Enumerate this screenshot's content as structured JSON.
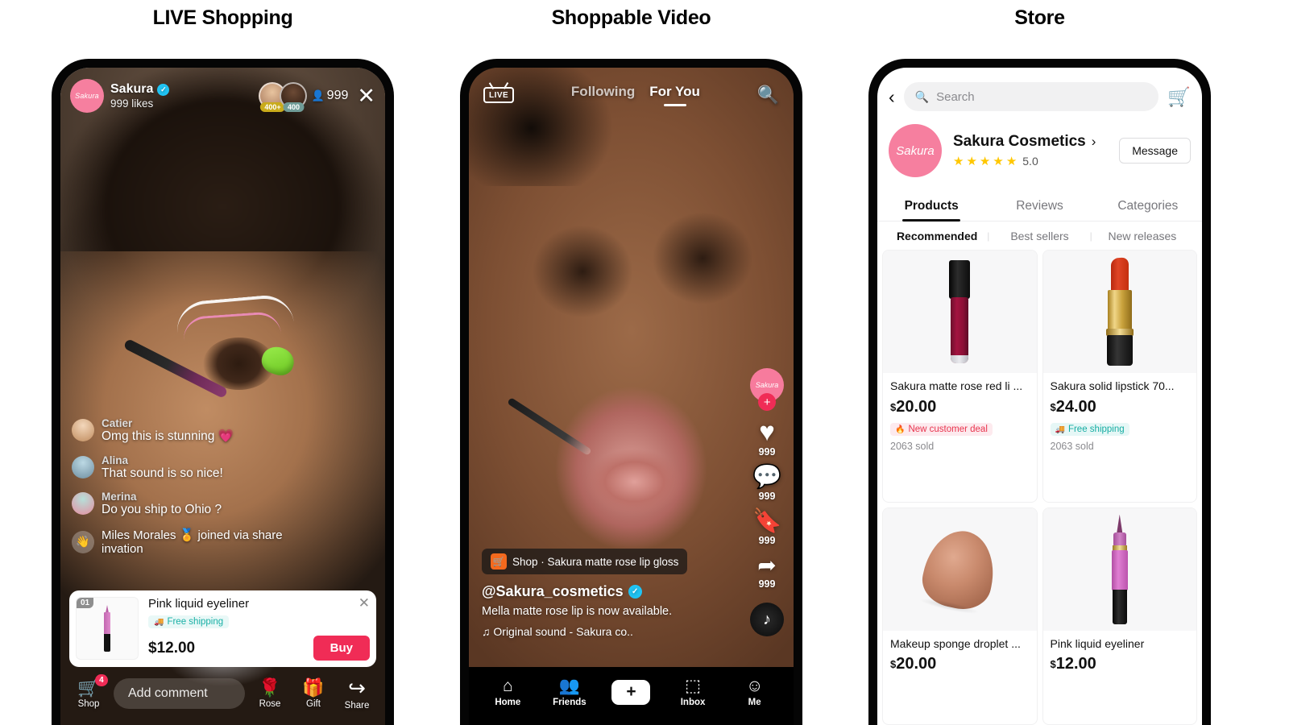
{
  "columns": [
    {
      "title": "LIVE Shopping"
    },
    {
      "title": "Shoppable Video"
    },
    {
      "title": "Store"
    }
  ],
  "live": {
    "host": {
      "avatar_label": "Sakura",
      "name": "Sakura",
      "likes": "999 likes",
      "verified_glyph": "✓"
    },
    "viewers": [
      {
        "badge": "400+",
        "badge_color": "#c9ab1b"
      },
      {
        "badge": "400",
        "badge_color": "#6f9c97"
      }
    ],
    "viewer_icon": "👤",
    "viewer_count": "999",
    "close_glyph": "✕",
    "chat": [
      {
        "name": "Catier",
        "message": "Omg this is stunning  💗"
      },
      {
        "name": "Alina",
        "message": "That sound is so nice!"
      },
      {
        "name": "Merina",
        "message": "Do you ship to Ohio ?"
      }
    ],
    "join_notice": {
      "icon": "👋",
      "text": "Miles Morales 🏅 joined via share invation"
    },
    "product": {
      "rank": "01",
      "title": "Pink liquid eyeliner",
      "shipping_tag": "Free shipping",
      "shipping_icon": "🚚",
      "price": "$12.00",
      "buy_label": "Buy",
      "close_glyph": "✕"
    },
    "bottom_bar": {
      "shop": {
        "icon": "🛒",
        "label": "Shop",
        "badge": "4"
      },
      "comment_placeholder": "Add comment",
      "rose": {
        "icon": "🌹",
        "label": "Rose"
      },
      "gift": {
        "icon": "🎁",
        "label": "Gift"
      },
      "share": {
        "icon": "↪",
        "label": "Share"
      }
    }
  },
  "video": {
    "live_badge": "LIVE",
    "tabs": [
      {
        "label": "Following",
        "active": false
      },
      {
        "label": "For You",
        "active": true
      }
    ],
    "search_glyph": "🔍",
    "rail": {
      "avatar_label": "Sakura",
      "follow_glyph": "+",
      "actions": [
        {
          "icon": "♥",
          "count": "999",
          "name": "like"
        },
        {
          "icon": "💬",
          "count": "999",
          "name": "comment"
        },
        {
          "icon": "🔖",
          "count": "999",
          "name": "bookmark"
        },
        {
          "icon": "➦",
          "count": "999",
          "name": "share"
        }
      ],
      "disc_glyph": "♪"
    },
    "shop_tag": {
      "cart_icon": "🛒",
      "text": "Shop · Sakura matte rose lip gloss"
    },
    "handle": "@Sakura_cosmetics",
    "verified_glyph": "✓",
    "description": "Mella matte rose lip is now available.",
    "sound": "♫ Original sound - Sakura co..",
    "tabbar": [
      {
        "icon": "⌂",
        "label": "Home"
      },
      {
        "icon": "👥",
        "label": "Friends"
      },
      {
        "icon": "+",
        "label": ""
      },
      {
        "icon": "⬚",
        "label": "Inbox"
      },
      {
        "icon": "☺",
        "label": "Me"
      }
    ]
  },
  "store": {
    "back_glyph": "‹",
    "search_placeholder": "Search",
    "search_icon": "🔍",
    "cart_icon": "🛒",
    "shop": {
      "avatar_label": "Sakura",
      "name": "Sakura Cosmetics",
      "chevron": "›",
      "stars": [
        "★",
        "★",
        "★",
        "★",
        "★"
      ],
      "rating": "5.0",
      "message_label": "Message"
    },
    "tabs": [
      {
        "label": "Products",
        "active": true
      },
      {
        "label": "Reviews",
        "active": false
      },
      {
        "label": "Categories",
        "active": false
      }
    ],
    "subtabs": [
      {
        "label": "Recommended",
        "active": true
      },
      {
        "label": "Best sellers",
        "active": false
      },
      {
        "label": "New releases",
        "active": false
      }
    ],
    "subtab_divider": "|",
    "products": [
      {
        "art": "gloss",
        "name": "Sakura matte rose red li ...",
        "currency": "$",
        "price": "20.00",
        "tag": "New customer deal",
        "tag_type": "deal",
        "tag_icon": "🔥",
        "sold": "2063 sold"
      },
      {
        "art": "lipstick",
        "name": "Sakura solid lipstick 70...",
        "currency": "$",
        "price": "24.00",
        "tag": "Free shipping",
        "tag_type": "ship",
        "tag_icon": "🚚",
        "sold": "2063 sold"
      },
      {
        "art": "sponge",
        "name": "Makeup sponge droplet ...",
        "currency": "$",
        "price": "20.00",
        "tag": "",
        "tag_type": "",
        "tag_icon": "",
        "sold": ""
      },
      {
        "art": "liner",
        "name": "Pink liquid eyeliner",
        "currency": "$",
        "price": "12.00",
        "tag": "",
        "tag_type": "",
        "tag_icon": "",
        "sold": ""
      }
    ]
  },
  "colors": {
    "brand_pink": "#f67f9f",
    "buy_red": "#f02c56",
    "teal_tag": "#19b0a6",
    "deal_red": "#e8344e",
    "star_yellow": "#ffc700",
    "verified_blue": "#20c4f4"
  }
}
